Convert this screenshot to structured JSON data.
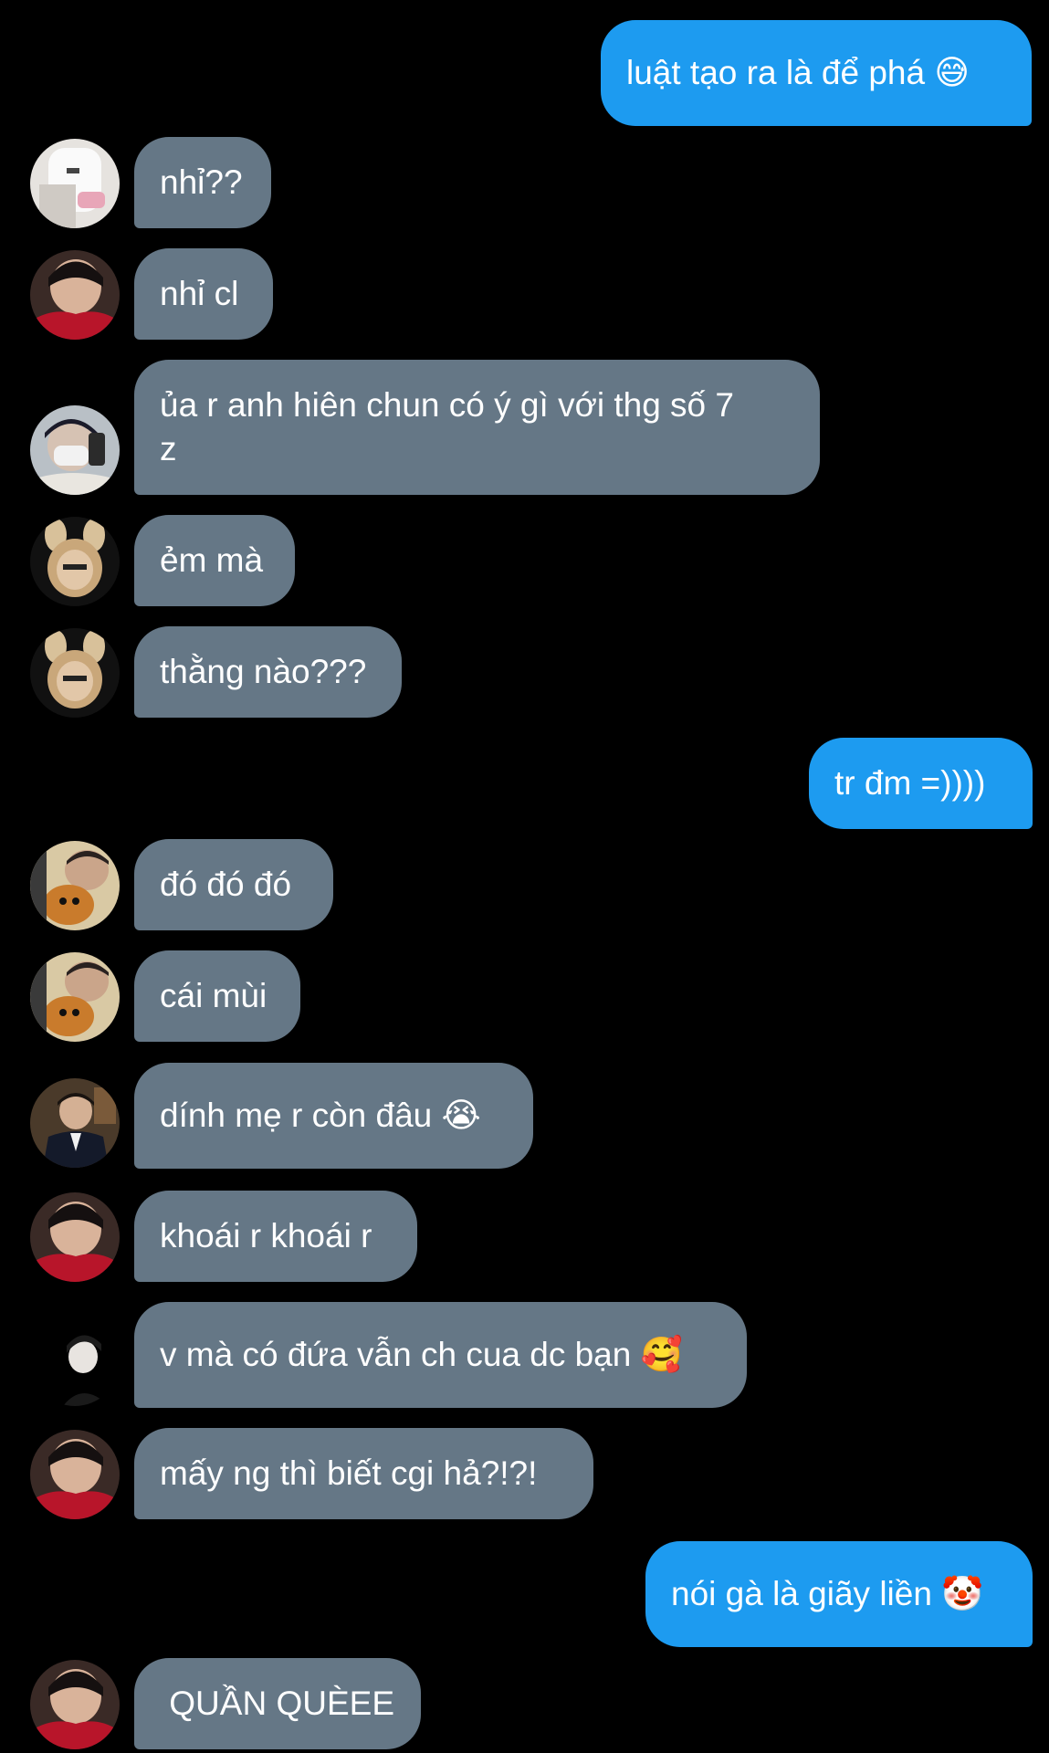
{
  "messages": [
    {
      "id": "m1",
      "from": "me",
      "text": "luật tạo ra là để phá 😅"
    },
    {
      "id": "m2",
      "from": "other",
      "avatar": "user-a-avatar",
      "text": "nhỉ??"
    },
    {
      "id": "m3",
      "from": "other",
      "avatar": "user-b-avatar",
      "text": "nhỉ cl"
    },
    {
      "id": "m4",
      "from": "other",
      "avatar": "user-c-avatar",
      "text": "ủa r anh hiên chun có ý gì với thg số 7\nz"
    },
    {
      "id": "m5",
      "from": "other",
      "avatar": "user-d-avatar",
      "text": "ẻm mà"
    },
    {
      "id": "m6",
      "from": "other",
      "avatar": "user-d-avatar",
      "text": "thằng nào???"
    },
    {
      "id": "m7",
      "from": "me",
      "text": "tr đm =))))"
    },
    {
      "id": "m8",
      "from": "other",
      "avatar": "user-e-avatar",
      "text": "đó đó đó"
    },
    {
      "id": "m9",
      "from": "other",
      "avatar": "user-e-avatar",
      "text": "cái mùi"
    },
    {
      "id": "m10",
      "from": "other",
      "avatar": "user-f-avatar",
      "text": "dính mẹ r còn đâu 😭"
    },
    {
      "id": "m11",
      "from": "other",
      "avatar": "user-b-avatar",
      "text": "khoái r khoái r"
    },
    {
      "id": "m12",
      "from": "other",
      "avatar": "user-g-avatar",
      "text": "v mà có đứa vẫn ch cua dc bạn 🥰"
    },
    {
      "id": "m13",
      "from": "other",
      "avatar": "user-b-avatar",
      "text": "mấy ng thì biết cgi hả?!?!"
    },
    {
      "id": "m14",
      "from": "me",
      "text": "nói gà là giãy liền 🤡"
    },
    {
      "id": "m15",
      "from": "other",
      "avatar": "user-b-avatar",
      "text": " QUẦN QUÈEE"
    }
  ],
  "colors": {
    "background": "#000000",
    "incoming_bubble": "#657786",
    "outgoing_bubble": "#1d9bf0",
    "text": "#ffffff"
  }
}
